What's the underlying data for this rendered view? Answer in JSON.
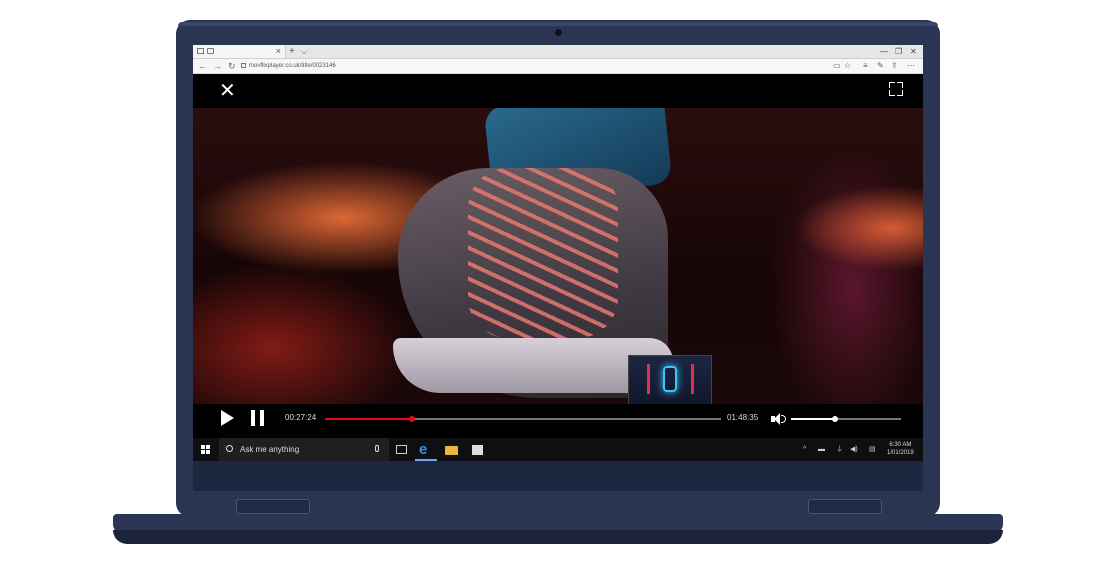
{
  "browser": {
    "url": "movflixplayer.co.uk/title/0023146",
    "new_tab": "+",
    "tab_menu": "⌵",
    "close_tab": "×",
    "window_controls": [
      "—",
      "❐",
      "✕"
    ],
    "nav": {
      "back": "←",
      "forward": "→",
      "refresh": "↻"
    },
    "toolbar_right": [
      "▭",
      "☆",
      "≡",
      "✎",
      "⇪",
      "⋯"
    ]
  },
  "player": {
    "close": "✕",
    "elapsed": "00:27:24",
    "total": "01:48:35",
    "progress_fraction": 0.22,
    "volume_fraction": 0.4,
    "progress_color": "#e50914"
  },
  "taskbar": {
    "search_placeholder": "Ask me anything",
    "edge_glyph": "e",
    "tray_icons": [
      "^",
      "▬",
      "⏚",
      "◀)",
      "▤"
    ],
    "time": "6:30 AM",
    "date": "1/01/2019"
  }
}
